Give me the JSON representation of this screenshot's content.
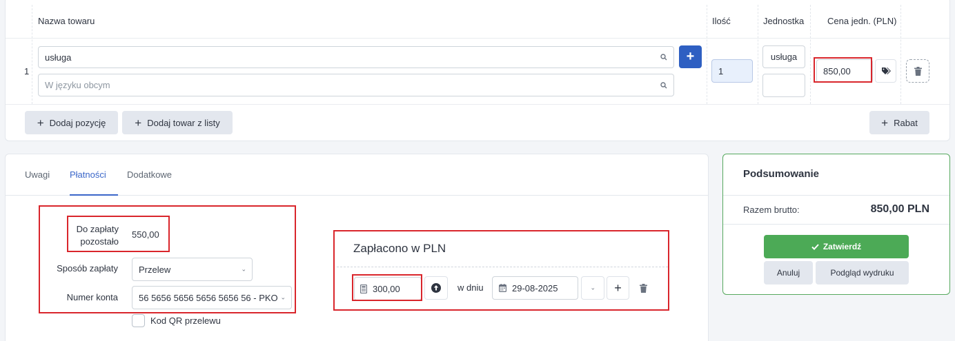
{
  "table": {
    "headers": {
      "name": "Nazwa towaru",
      "qty": "Ilość",
      "unit": "Jednostka",
      "price": "Cena jedn. (PLN)"
    },
    "row": {
      "index": "1",
      "name_value": "usługa",
      "foreign_placeholder": "W języku obcym",
      "qty_value": "1",
      "unit_value": "usługa",
      "unit_extra_value": "",
      "price_value": "850,00"
    },
    "actions": {
      "add_position": "Dodaj pozycję",
      "add_from_list": "Dodaj towar z listy",
      "discount": "Rabat"
    },
    "add_button_label": "+"
  },
  "tabs": [
    {
      "label": "Uwagi",
      "active": false
    },
    {
      "label": "Płatności",
      "active": true
    },
    {
      "label": "Dodatkowe",
      "active": false
    }
  ],
  "payment": {
    "remaining_label_line1": "Do zapłaty",
    "remaining_label_line2": "pozostało",
    "remaining_value": "550,00",
    "method_label": "Sposób zapłaty",
    "method_value": "Przelew",
    "account_label": "Numer konta",
    "account_value": "56 5656 5656 5656 5656 56 - PKO",
    "qr_label": "Kod QR przelewu",
    "qr_checked": false
  },
  "paid": {
    "title": "Zapłacono w PLN",
    "amount": "300,00",
    "on_day_label": "w dniu",
    "date": "29-08-2025"
  },
  "summary": {
    "title": "Podsumowanie",
    "gross_label": "Razem brutto:",
    "gross_value": "850,00 PLN",
    "approve": "Zatwierdź",
    "cancel": "Anuluj",
    "preview": "Podgląd wydruku"
  },
  "colors": {
    "accent_blue": "#2e5fc2",
    "highlight_red": "#d9252b",
    "approve_green": "#4caa56",
    "tab_active": "#3a66c9"
  }
}
